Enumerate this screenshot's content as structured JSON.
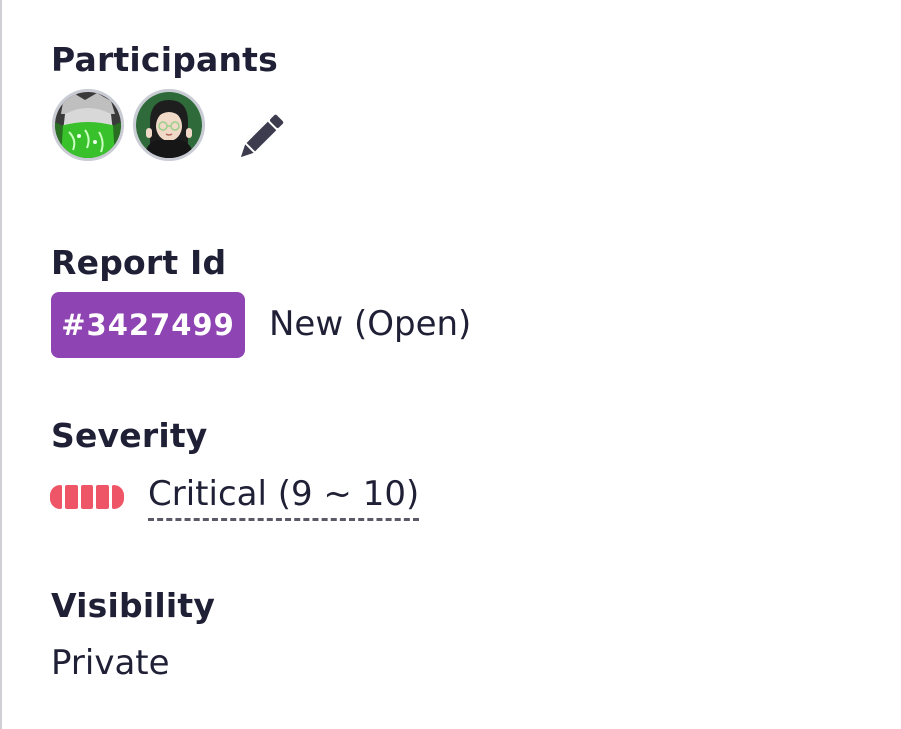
{
  "participants": {
    "label": "Participants",
    "avatars": [
      {
        "name": "participant-avatar-1",
        "colors": {
          "bg": "#2f7d2a",
          "fg": "#7ff06a"
        }
      },
      {
        "name": "participant-avatar-2",
        "colors": {
          "bg": "#2b5b33",
          "fg": "#1a1a1a"
        }
      }
    ],
    "edit_icon": "pencil-icon"
  },
  "report": {
    "label": "Report Id",
    "id": "#3427499",
    "status": "New (Open)",
    "badge_color": "#8e44b3"
  },
  "severity": {
    "label": "Severity",
    "value": "Critical (9 ~ 10)",
    "level": 5,
    "max_level": 5,
    "color": "#ee5566"
  },
  "visibility": {
    "label": "Visibility",
    "value": "Private"
  }
}
